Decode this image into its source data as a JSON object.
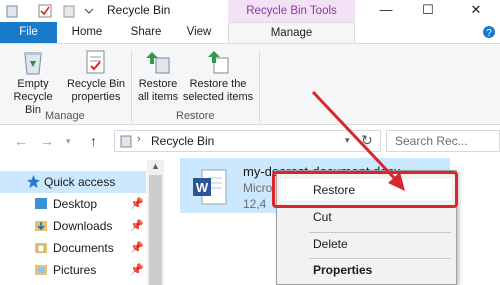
{
  "window": {
    "title": "Recycle Bin",
    "context_tab_title": "Recycle Bin Tools",
    "minimize": "—",
    "maximize": "☐",
    "close": "✕"
  },
  "tabs": [
    {
      "label": "File"
    },
    {
      "label": "Home"
    },
    {
      "label": "Share"
    },
    {
      "label": "View"
    },
    {
      "label": "Manage"
    }
  ],
  "ribbon": {
    "manage_group": {
      "label": "Manage",
      "empty_line1": "Empty",
      "empty_line2": "Recycle Bin",
      "props_line1": "Recycle Bin",
      "props_line2": "properties"
    },
    "restore_group": {
      "label": "Restore",
      "all_line1": "Restore",
      "all_line2": "all items",
      "sel_line1": "Restore the",
      "sel_line2": "selected items"
    }
  },
  "address": {
    "path": "Recycle Bin",
    "search_placeholder": "Search Rec..."
  },
  "nav_pane": {
    "items": [
      {
        "label": "Quick access"
      },
      {
        "label": "Desktop"
      },
      {
        "label": "Downloads"
      },
      {
        "label": "Documents"
      },
      {
        "label": "Pictures"
      }
    ]
  },
  "content": {
    "file": {
      "name": "my-dearest-document.docx",
      "type": "Micro",
      "size": "12,4"
    }
  },
  "context_menu": {
    "items": [
      {
        "label": "Restore"
      },
      {
        "label": "Cut"
      },
      {
        "label": "Delete"
      },
      {
        "label": "Properties"
      }
    ]
  },
  "colors": {
    "accent": "#1979ca",
    "highlight_red": "#d9262b",
    "selection": "#cce8ff",
    "context_tab": "#8b3a9b"
  }
}
